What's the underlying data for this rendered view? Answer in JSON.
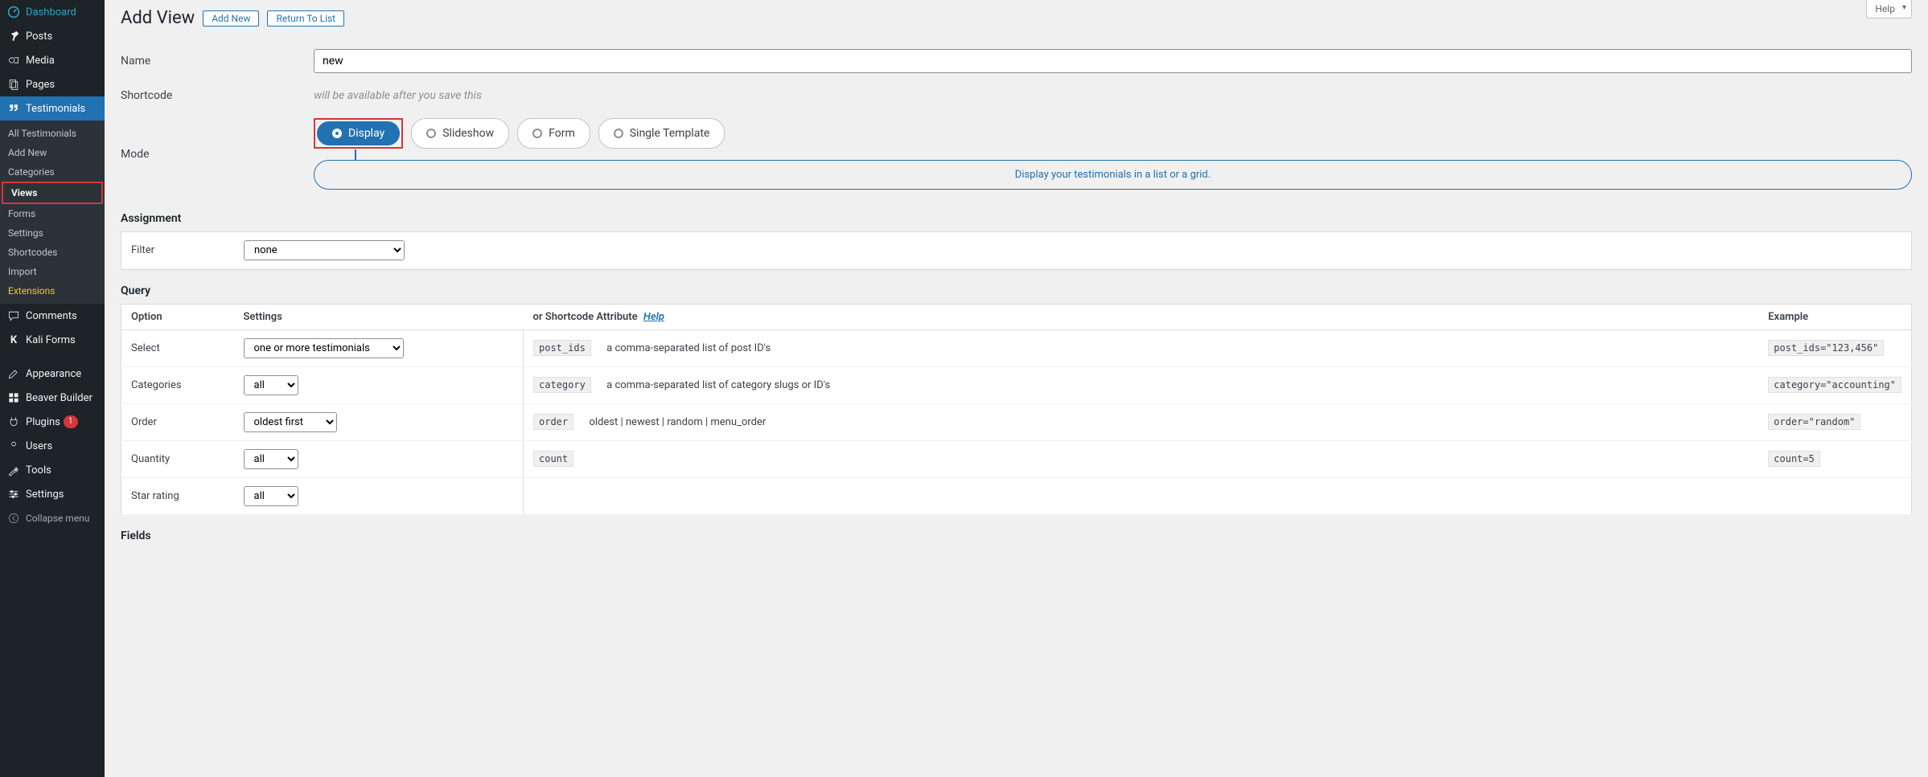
{
  "help_tab": "Help",
  "sidebar": {
    "dashboard": "Dashboard",
    "posts": "Posts",
    "media": "Media",
    "pages": "Pages",
    "testimonials": "Testimonials",
    "sub": {
      "all": "All Testimonials",
      "addnew": "Add New",
      "categories": "Categories",
      "views": "Views",
      "forms": "Forms",
      "settings": "Settings",
      "shortcodes": "Shortcodes",
      "import": "Import",
      "extensions": "Extensions"
    },
    "comments": "Comments",
    "kaliforms": "Kali Forms",
    "appearance": "Appearance",
    "beaver": "Beaver Builder",
    "plugins": "Plugins",
    "plugins_badge": "1",
    "users": "Users",
    "tools": "Tools",
    "settings": "Settings",
    "collapse": "Collapse menu"
  },
  "header": {
    "title": "Add View",
    "add_new": "Add New",
    "return": "Return To List"
  },
  "form": {
    "name_label": "Name",
    "name_value": "new",
    "shortcode_label": "Shortcode",
    "shortcode_note": "will be available after you save this",
    "mode_label": "Mode",
    "modes": {
      "display": "Display",
      "slideshow": "Slideshow",
      "form": "Form",
      "single": "Single Template"
    },
    "mode_desc": "Display your testimonials in a list or a grid."
  },
  "assignment": {
    "heading": "Assignment",
    "filter_label": "Filter",
    "filter_value": "none"
  },
  "query": {
    "heading": "Query",
    "cols": {
      "option": "Option",
      "settings": "Settings",
      "attr": "or Shortcode Attribute",
      "help": "Help",
      "example": "Example"
    },
    "rows": [
      {
        "option": "Select",
        "setting": "one or more testimonials",
        "attr": "post_ids",
        "desc": "a comma-separated list of post ID's",
        "example": "post_ids=\"123,456\""
      },
      {
        "option": "Categories",
        "setting": "all",
        "attr": "category",
        "desc": "a comma-separated list of category slugs or ID's",
        "example": "category=\"accounting\""
      },
      {
        "option": "Order",
        "setting": "oldest first",
        "attr": "order",
        "desc": "oldest | newest | random | menu_order",
        "example": "order=\"random\""
      },
      {
        "option": "Quantity",
        "setting": "all",
        "attr": "count",
        "desc": "",
        "example": "count=5"
      },
      {
        "option": "Star rating",
        "setting": "all",
        "attr": "",
        "desc": "",
        "example": ""
      }
    ]
  },
  "fields": {
    "heading": "Fields"
  }
}
